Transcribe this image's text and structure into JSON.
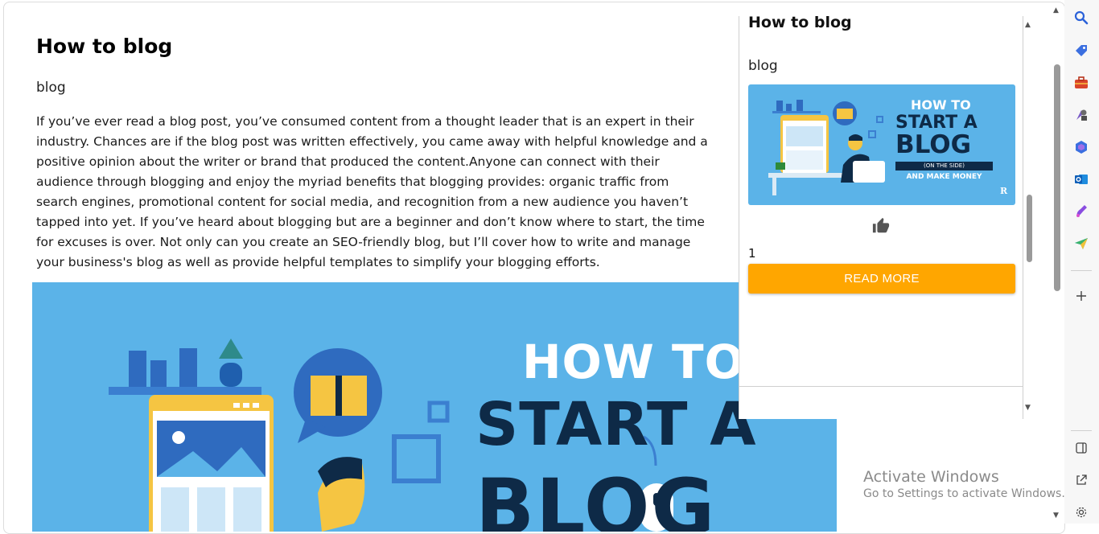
{
  "article": {
    "title": "How to blog",
    "category": "blog",
    "body": "If you’ve ever read a blog post, you’ve consumed content from a thought leader that is an expert in their industry. Chances are if the blog post was written effectively, you came away with helpful knowledge and a positive opinion about the writer or brand that produced the content.Anyone can connect with their audience through blogging and enjoy the myriad benefits that blogging provides: organic traffic from search engines, promotional content for social media, and recognition from a new audience you haven’t tapped into yet. If you’ve heard about blogging but are a beginner and don’t know where to start, the time for excuses is over. Not only can you create an SEO-friendly blog, but I’ll cover how to write and manage your business's blog as well as provide helpful templates to simplify your blogging efforts.",
    "hero": {
      "line1": "HOW TO",
      "line2": "START A",
      "line3": "BLOG"
    }
  },
  "panel": {
    "title": "How to blog",
    "category": "blog",
    "thumb": {
      "line1": "HOW TO",
      "line2": "START A",
      "line3": "BLOG",
      "line4": "(ON THE SIDE)",
      "line5": "AND MAKE MONEY",
      "mark": "R"
    },
    "like_icon": "thumbs-up-icon",
    "like_count": "1",
    "read_more_label": "READ MORE"
  },
  "edge_sidebar": {
    "icons": [
      "search-icon",
      "tag-icon",
      "toolbox-icon",
      "games-icon",
      "copilot-icon",
      "outlook-icon",
      "designer-icon",
      "send-icon",
      "add-icon",
      "split-view-icon",
      "external-link-icon",
      "settings-icon"
    ]
  },
  "watermark": {
    "title": "Activate Windows",
    "subtitle": "Go to Settings to activate Windows."
  },
  "colors": {
    "accent": "#ffa600",
    "hero_bg": "#5bb3e8",
    "navy": "#0e2a47",
    "yellow": "#f5c542"
  }
}
